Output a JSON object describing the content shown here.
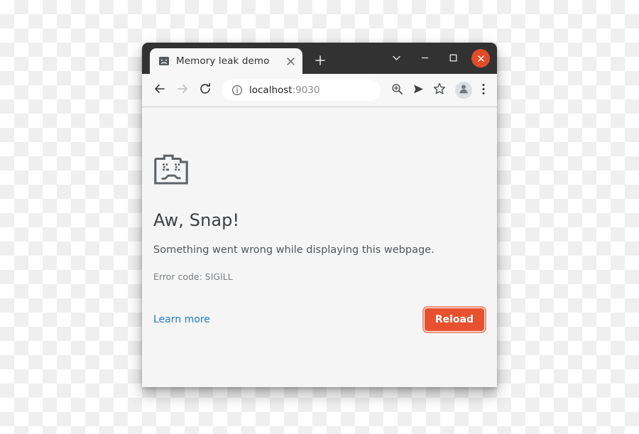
{
  "window": {
    "titlebar": {
      "tab": {
        "title": "Memory leak demo",
        "favicon_icon": "sad-page-favicon-icon",
        "close_icon": "close-icon"
      },
      "new_tab_icon": "plus-icon",
      "controls": {
        "tab_search_icon": "chevron-down-icon",
        "minimize_icon": "minimize-icon",
        "maximize_icon": "maximize-icon",
        "close_icon": "close-icon",
        "close_color": "#e04d28"
      }
    },
    "toolbar": {
      "back_icon": "back-arrow-icon",
      "forward_icon": "forward-arrow-icon",
      "reload_icon": "reload-icon",
      "site_info_icon": "info-circle-icon",
      "url_host": "localhost",
      "url_port": ":9030",
      "url_full": "localhost:9030",
      "zoom_icon": "zoom-in-icon",
      "share_icon": "send-icon",
      "bookmark_icon": "star-icon",
      "profile_icon": "account-avatar-icon",
      "menu_icon": "three-dot-menu-icon"
    }
  },
  "error_page": {
    "icon": "sad-page-icon",
    "headline": "Aw, Snap!",
    "subtext": "Something went wrong while displaying this webpage.",
    "error_code": "Error code: SIGILL",
    "learn_more_label": "Learn more",
    "reload_label": "Reload",
    "link_color": "#1f7bc4",
    "button_color": "#e8512f"
  }
}
